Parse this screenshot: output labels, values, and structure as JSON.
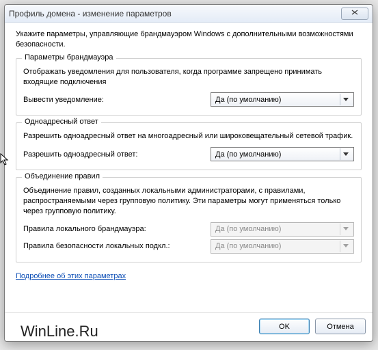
{
  "window": {
    "title": "Профиль домена - изменение параметров",
    "intro": "Укажите параметры, управляющие брандмауэром Windows с дополнительными возможностями безопасности."
  },
  "group1": {
    "title": "Параметры брандмауэра",
    "desc": "Отображать уведомления для пользователя, когда программе запрещено принимать входящие подключения",
    "row_label": "Вывести уведомление:",
    "row_value": "Да (по умолчанию)"
  },
  "group2": {
    "title": "Одноадресный ответ",
    "desc": "Разрешить одноадресный ответ на многоадресный или широковещательный сетевой трафик.",
    "row_label": "Разрешить одноадресный ответ:",
    "row_value": "Да (по умолчанию)"
  },
  "group3": {
    "title": "Объединение правил",
    "desc": "Объединение правил, созданных локальными администраторами, с правилами, распространяемыми через групповую политику. Эти параметры могут применяться только через групповую политику.",
    "row1_label": "Правила локального брандмауэра:",
    "row1_value": "Да (по умолчанию)",
    "row2_label": "Правила безопасности локальных подкл.:",
    "row2_value": "Да (по умолчанию)"
  },
  "link_text": "Подробнее об этих параметрах",
  "buttons": {
    "ok": "OK",
    "cancel": "Отмена"
  },
  "watermark": "WinLine.Ru"
}
